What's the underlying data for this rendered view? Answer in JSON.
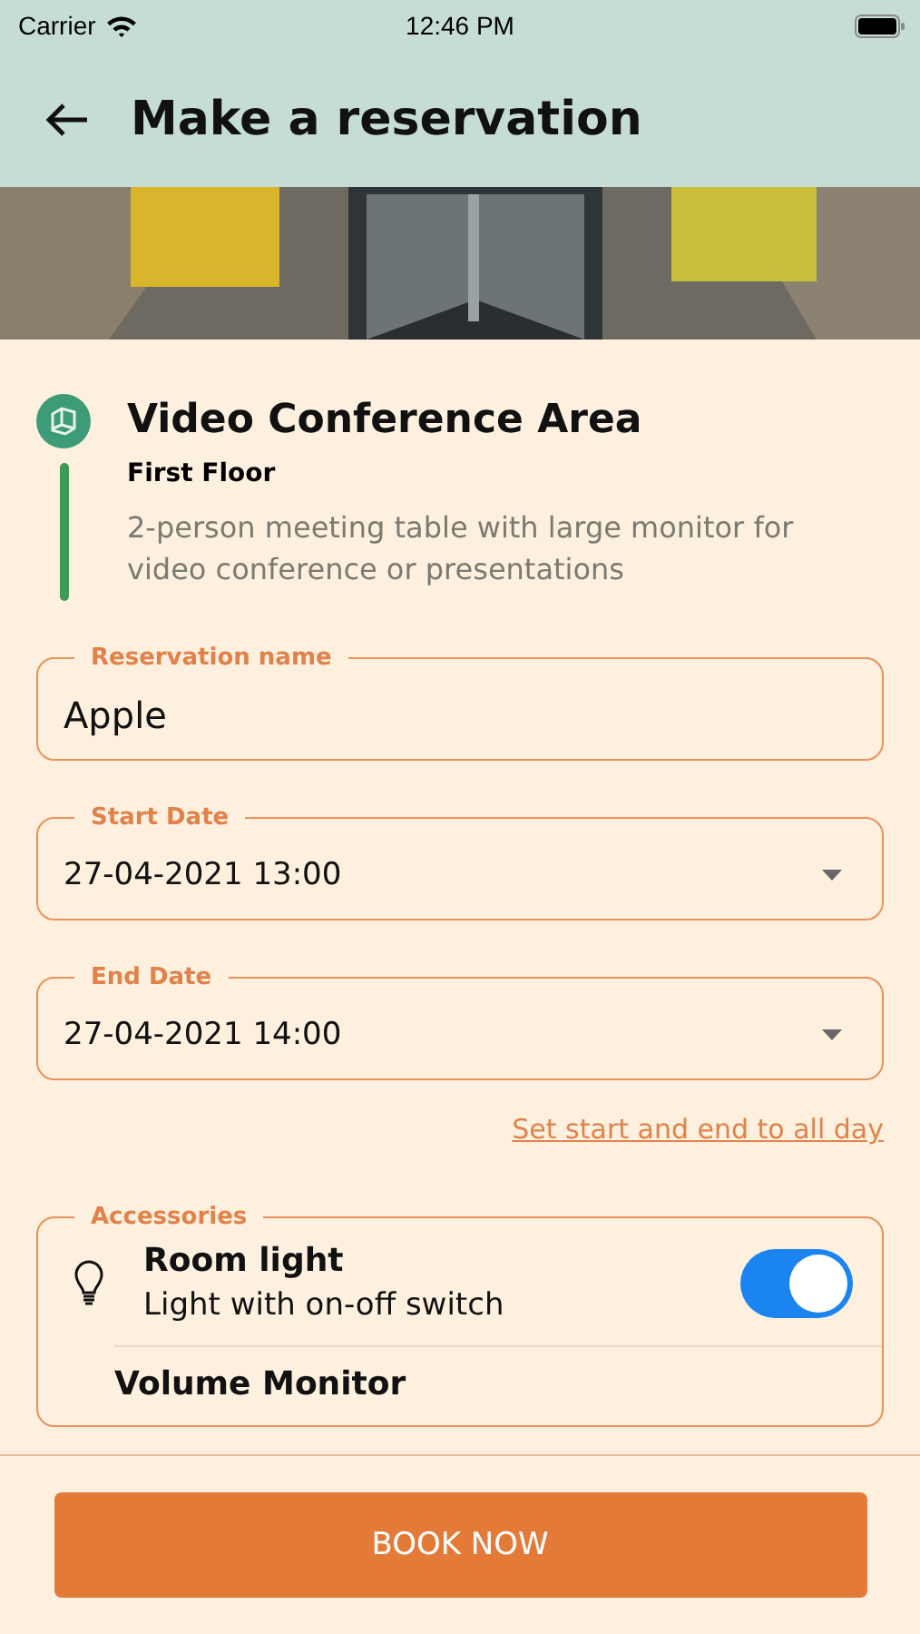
{
  "status_bar": {
    "carrier": "Carrier",
    "time": "12:46 PM"
  },
  "header": {
    "title": "Make a reservation"
  },
  "venue": {
    "name": "Video Conference Area",
    "floor": "First Floor",
    "description": "2-person meeting table with large monitor for video conference or presentations"
  },
  "fields": [
    {
      "label": "Reservation name",
      "value": "Apple",
      "kind": "text"
    },
    {
      "label": "Start Date",
      "value": "27-04-2021 13:00",
      "kind": "dropdown"
    },
    {
      "label": "End Date",
      "value": "27-04-2021 14:00",
      "kind": "dropdown"
    }
  ],
  "all_day_link": "Set start and end to all day",
  "accessories": {
    "label": "Accessories",
    "items": [
      {
        "name": "Room light",
        "description": "Light with on-off switch",
        "on": true,
        "kind": "light"
      },
      {
        "name": "Volume Monitor",
        "kind": "none"
      }
    ]
  },
  "book_button": "BOOK NOW"
}
